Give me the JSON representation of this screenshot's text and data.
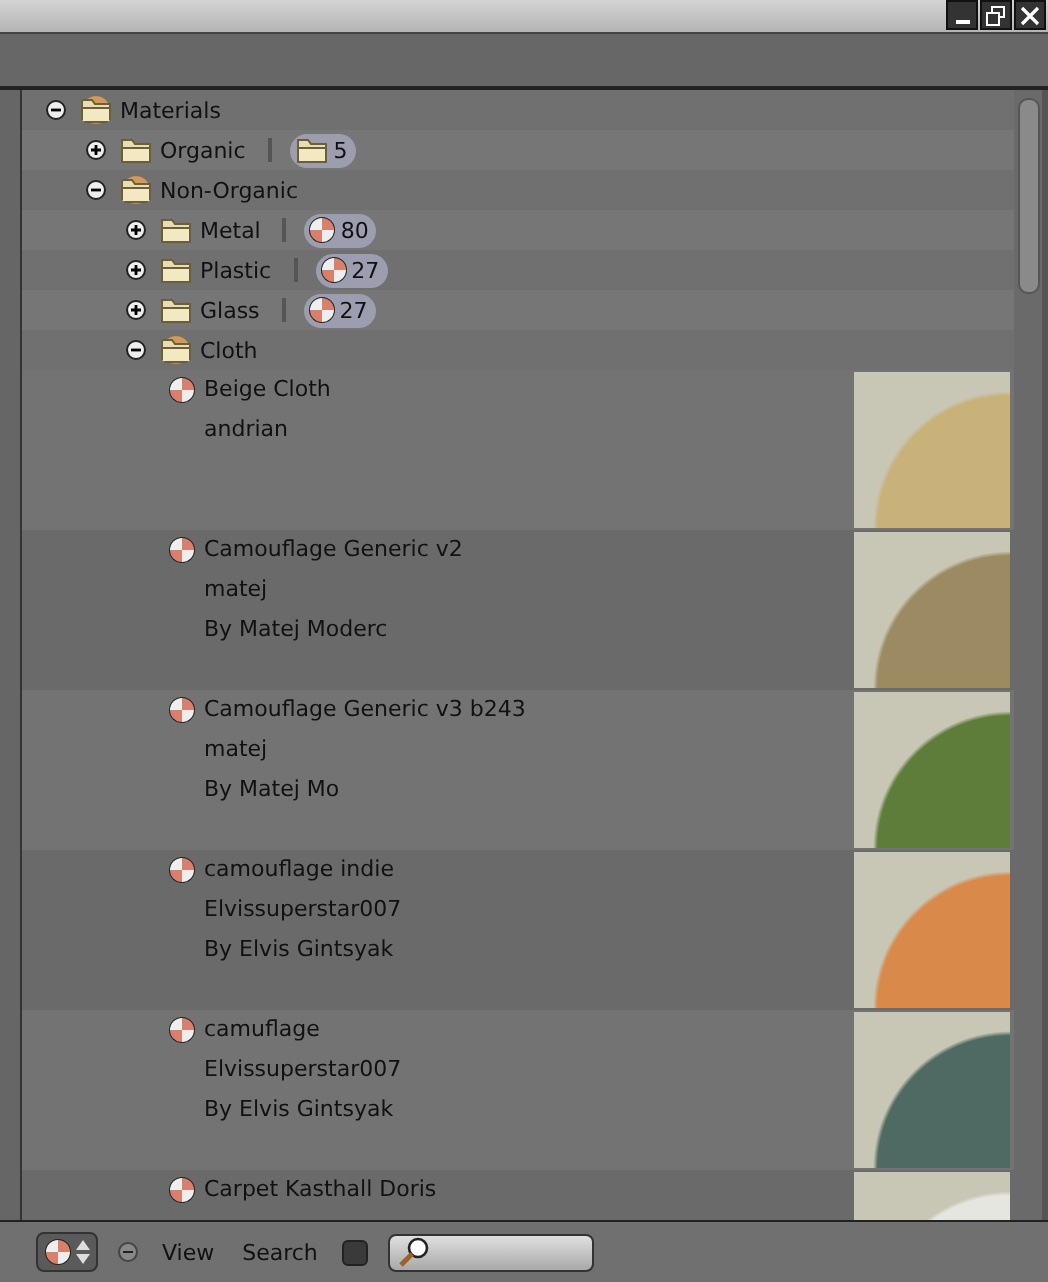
{
  "tree": [
    {
      "kind": "folder",
      "name": "Materials",
      "expanded": true,
      "children": [
        {
          "kind": "folder",
          "name": "Organic",
          "expanded": false,
          "badge": {
            "kind": "folder",
            "count": "5"
          }
        },
        {
          "kind": "folder",
          "name": "Non-Organic",
          "expanded": true,
          "children": [
            {
              "kind": "folder",
              "name": "Metal",
              "expanded": false,
              "badge": {
                "kind": "material",
                "count": "80"
              }
            },
            {
              "kind": "folder",
              "name": "Plastic",
              "expanded": false,
              "badge": {
                "kind": "material",
                "count": "27"
              }
            },
            {
              "kind": "folder",
              "name": "Glass",
              "expanded": false,
              "badge": {
                "kind": "material",
                "count": "27"
              }
            },
            {
              "kind": "folder",
              "name": "Cloth",
              "expanded": true,
              "children": [
                {
                  "kind": "material",
                  "name": "Beige Cloth",
                  "lines": [
                    "andrian"
                  ],
                  "color": "#c9b27a"
                },
                {
                  "kind": "material",
                  "name": "Camouflage Generic v2",
                  "lines": [
                    "matej",
                    "By Matej Moderc"
                  ],
                  "color": "#9c8b62"
                },
                {
                  "kind": "material",
                  "name": "Camouflage Generic v3 b243",
                  "lines": [
                    "matej",
                    "By Matej Mo"
                  ],
                  "color": "#5e7d3a"
                },
                {
                  "kind": "material",
                  "name": "camouflage indie",
                  "lines": [
                    "Elvissuperstar007",
                    "By Elvis Gintsyak"
                  ],
                  "color": "#d9894a"
                },
                {
                  "kind": "material",
                  "name": "camuflage",
                  "lines": [
                    "Elvissuperstar007",
                    "By Elvis Gintsyak"
                  ],
                  "color": "#4f6a62"
                },
                {
                  "kind": "material",
                  "name": "Carpet Kasthall Doris",
                  "color": "#e6e6e0"
                }
              ]
            }
          ]
        }
      ]
    }
  ],
  "footer": {
    "menus": [
      "View",
      "Search"
    ],
    "filter_checked": false
  }
}
